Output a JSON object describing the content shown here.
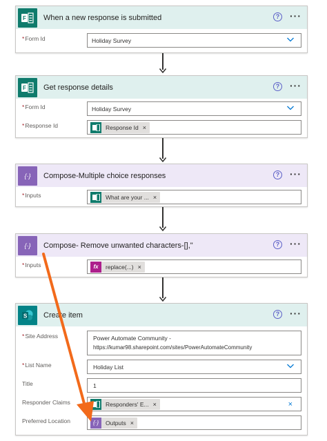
{
  "colors": {
    "forms_teal": "#0f7b6c",
    "compose_purple": "#8764b8",
    "sharepoint_teal": "#038387",
    "annotation_orange": "#f26a1b"
  },
  "cards": {
    "trigger": {
      "title": "When a new response is submitted",
      "icon": "forms-icon",
      "form_id_label": "Form Id",
      "form_id_value": "Holiday Survey"
    },
    "get_details": {
      "title": "Get response details",
      "icon": "forms-icon",
      "form_id_label": "Form Id",
      "form_id_value": "Holiday Survey",
      "response_id_label": "Response Id",
      "response_id_token": "Response Id"
    },
    "compose1": {
      "title": "Compose-Multiple choice responses",
      "icon": "compose-icon",
      "inputs_label": "Inputs",
      "inputs_token": "What are your ..."
    },
    "compose2": {
      "title": "Compose- Remove unwanted characters-[],\"",
      "icon": "compose-icon",
      "inputs_label": "Inputs",
      "inputs_token": "replace(...)"
    },
    "create_item": {
      "title": "Create item",
      "icon": "sharepoint-icon",
      "site_label": "Site Address",
      "site_value_line1": "Power Automate Community -",
      "site_value_line2": "https://kumar98.sharepoint.com/sites/PowerAutomateCommunity",
      "list_label": "List Name",
      "list_value": "Holiday List",
      "title_label": "Title",
      "title_value": "1",
      "claims_label": "Responder Claims",
      "claims_token": "Responders' E...",
      "location_label": "Preferred Location",
      "location_token": "Outputs"
    }
  },
  "help_glyph": "?",
  "more_glyph": "···",
  "token_remove_glyph": "×",
  "fx_glyph": "fx",
  "compose_glyph": "{·}",
  "req_mark": "*"
}
